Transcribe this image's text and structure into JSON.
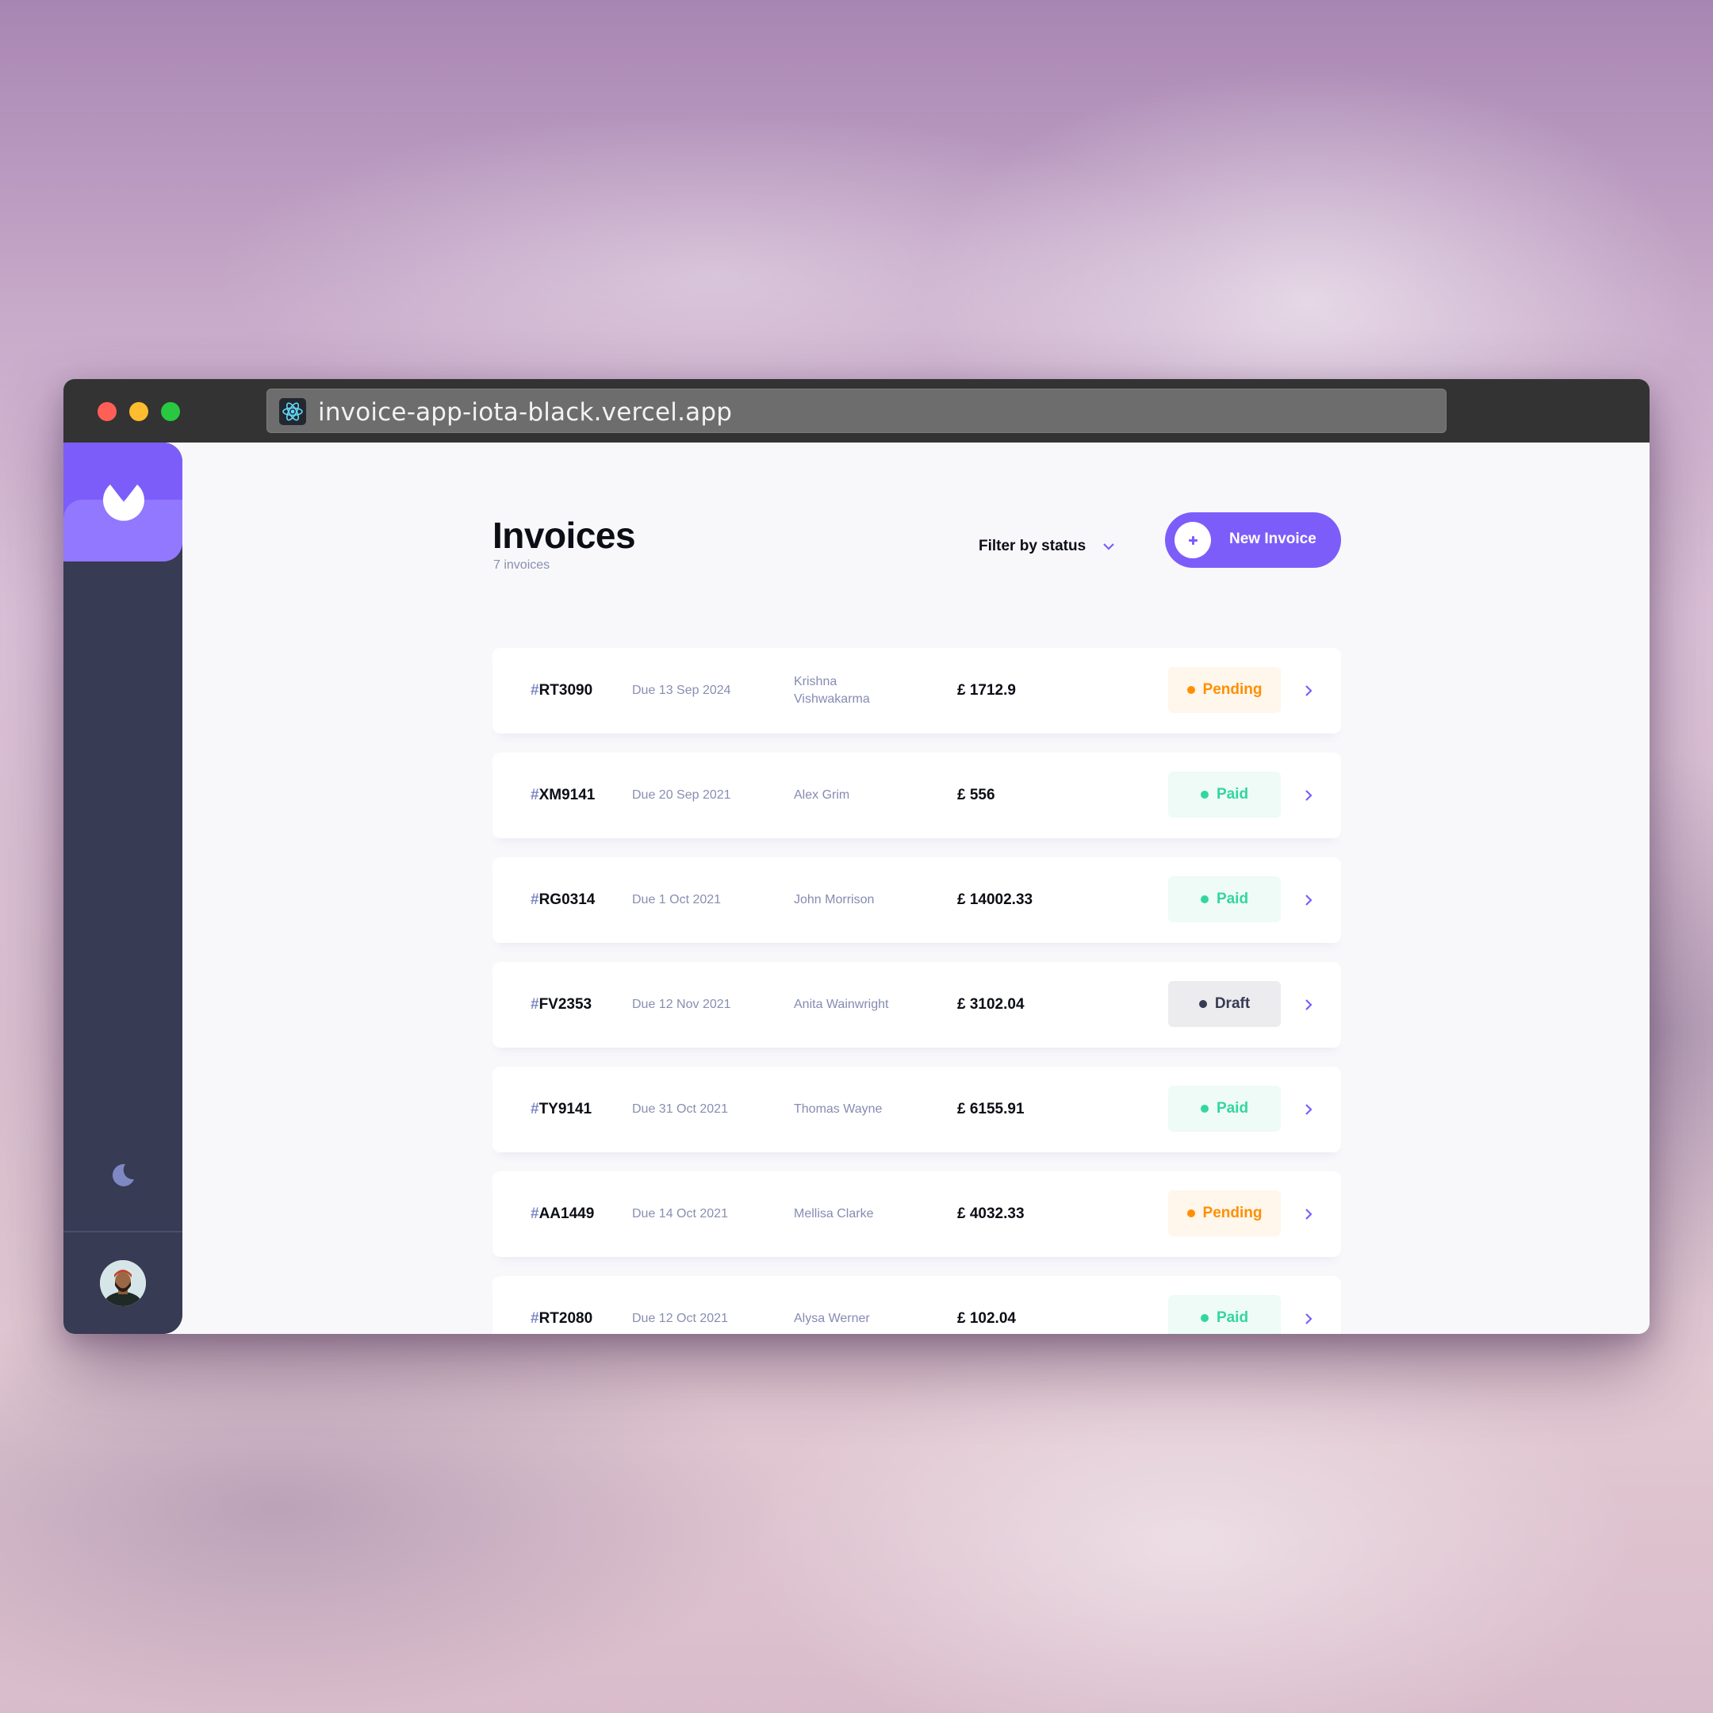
{
  "browser": {
    "url": "invoice-app-iota-black.vercel.app",
    "favicon_icon": "react-atom-icon"
  },
  "sidebar": {
    "logo_icon": "app-logo-icon",
    "theme_toggle_icon": "moon-icon",
    "avatar_icon": "user-avatar"
  },
  "header": {
    "title": "Invoices",
    "subtitle": "7 invoices",
    "filter_label": "Filter by status",
    "new_button_label": "New Invoice"
  },
  "invoices": [
    {
      "hash": "#",
      "id": "RT3090",
      "due": "Due 13 Sep 2024",
      "client": "Krishna Vishwakarma",
      "amount": "£ 1712.9",
      "status": "Pending"
    },
    {
      "hash": "#",
      "id": "XM9141",
      "due": "Due 20 Sep 2021",
      "client": "Alex Grim",
      "amount": "£ 556",
      "status": "Paid"
    },
    {
      "hash": "#",
      "id": "RG0314",
      "due": "Due 1 Oct 2021",
      "client": "John Morrison",
      "amount": "£ 14002.33",
      "status": "Paid"
    },
    {
      "hash": "#",
      "id": "FV2353",
      "due": "Due 12 Nov 2021",
      "client": "Anita Wainwright",
      "amount": "£ 3102.04",
      "status": "Draft"
    },
    {
      "hash": "#",
      "id": "TY9141",
      "due": "Due 31 Oct 2021",
      "client": "Thomas Wayne",
      "amount": "£ 6155.91",
      "status": "Paid"
    },
    {
      "hash": "#",
      "id": "AA1449",
      "due": "Due 14 Oct 2021",
      "client": "Mellisa Clarke",
      "amount": "£ 4032.33",
      "status": "Pending"
    },
    {
      "hash": "#",
      "id": "RT2080",
      "due": "Due 12 Oct 2021",
      "client": "Alysa Werner",
      "amount": "£ 102.04",
      "status": "Paid"
    }
  ],
  "colors": {
    "accent": "#7c5dfa",
    "sidebar": "#373b53",
    "pending": "#ff8f00",
    "paid": "#33d69f",
    "draft": "#373b53"
  }
}
